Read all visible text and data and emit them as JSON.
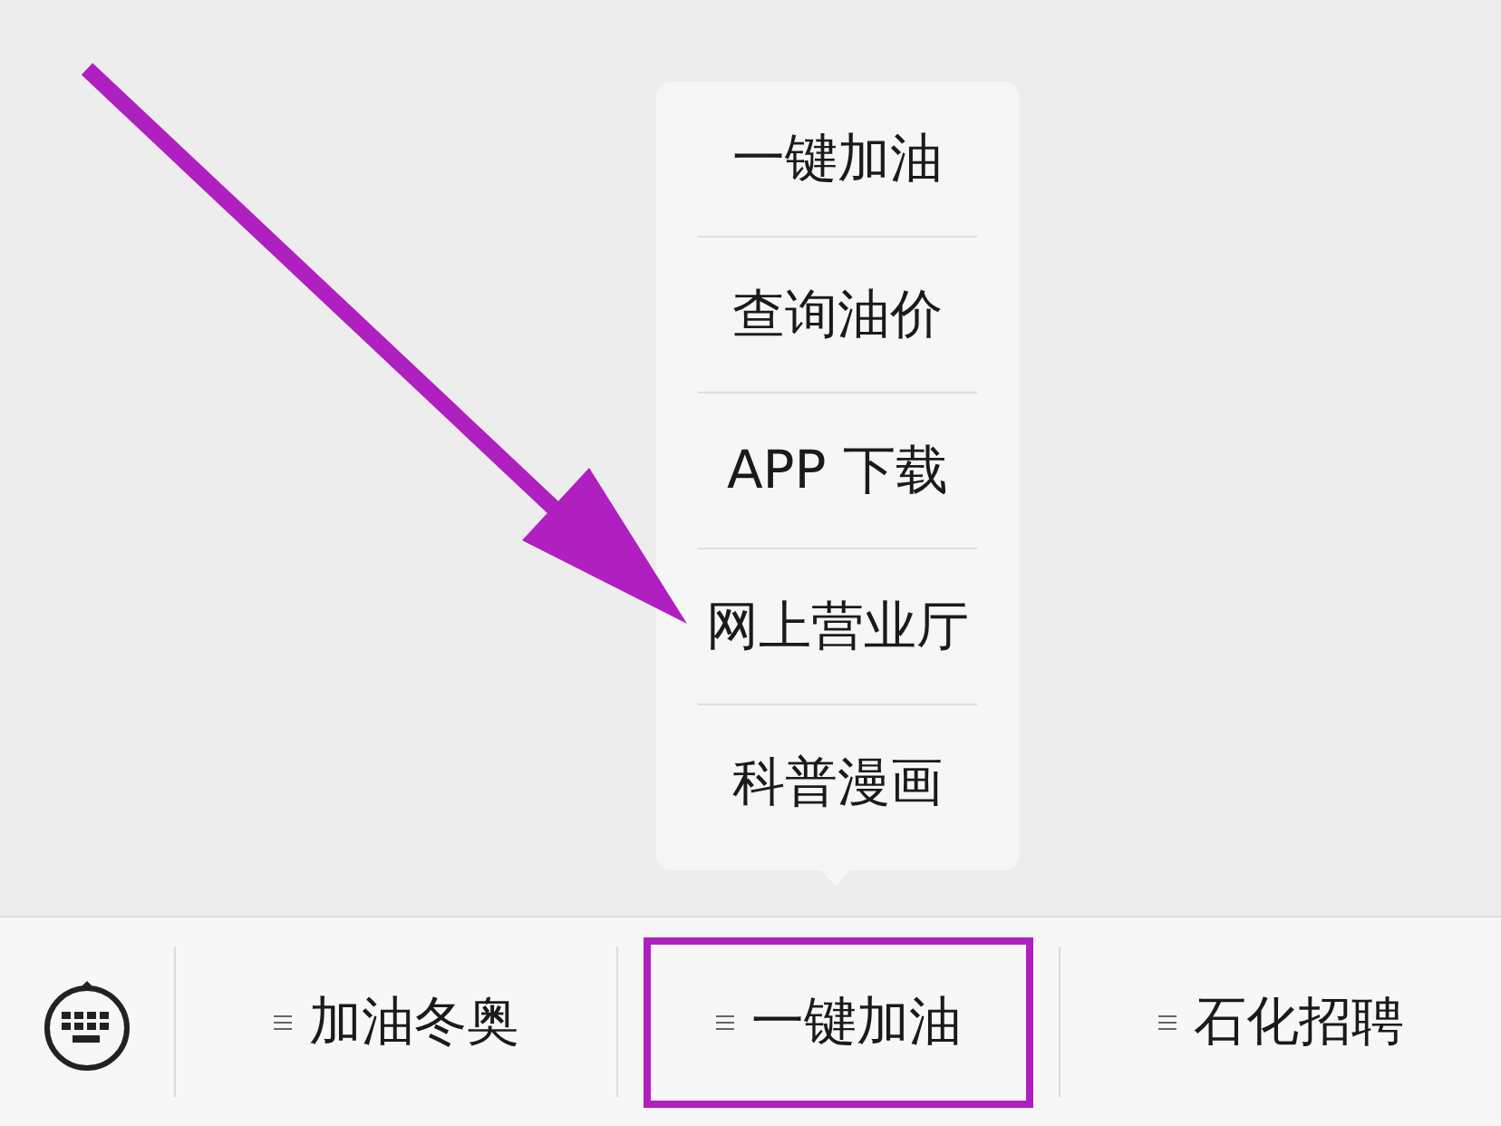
{
  "popup_menu": {
    "items": [
      {
        "label": "一键加油"
      },
      {
        "label": "查询油价"
      },
      {
        "label": "APP 下载"
      },
      {
        "label": "网上营业厅"
      },
      {
        "label": "科普漫画"
      }
    ]
  },
  "bottom_menu": {
    "tabs": [
      {
        "label": "加油冬奥",
        "highlighted": false
      },
      {
        "label": "一键加油",
        "highlighted": true
      },
      {
        "label": "石化招聘",
        "highlighted": false
      }
    ]
  }
}
